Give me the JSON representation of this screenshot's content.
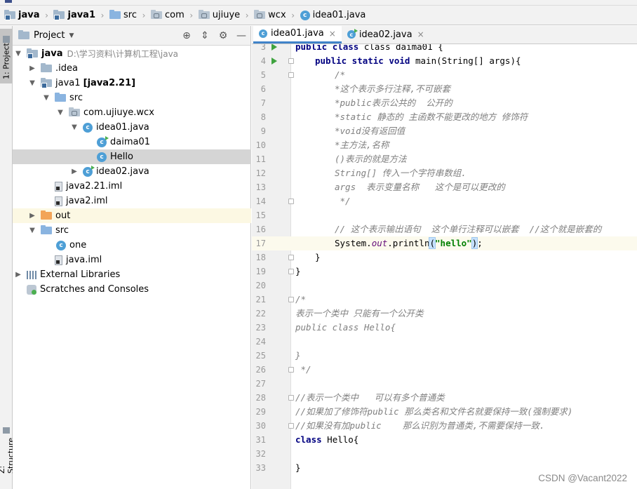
{
  "breadcrumb": [
    "java",
    "java1",
    "src",
    "com",
    "ujiuye",
    "wcx",
    "idea01.java"
  ],
  "left_tools": {
    "project": "1: Project",
    "structure": "Z: Structure"
  },
  "project_panel": {
    "title": "Project",
    "tree": [
      {
        "label": "java",
        "extra": "D:\\学习资料\\计算机工程\\java",
        "bold": true
      },
      {
        "label": ".idea"
      },
      {
        "label": "java1",
        "extra": "[java2.21]",
        "bold_extra": true
      },
      {
        "label": "src"
      },
      {
        "label": "com.ujiuye.wcx"
      },
      {
        "label": "idea01.java"
      },
      {
        "label": "daima01"
      },
      {
        "label": "Hello"
      },
      {
        "label": "idea02.java"
      },
      {
        "label": "java2.21.iml"
      },
      {
        "label": "java2.iml"
      },
      {
        "label": "out"
      },
      {
        "label": "src"
      },
      {
        "label": "one"
      },
      {
        "label": "java.iml"
      },
      {
        "label": "External Libraries"
      },
      {
        "label": "Scratches and Consoles"
      }
    ]
  },
  "editor": {
    "tabs": [
      {
        "label": "idea01.java",
        "active": true
      },
      {
        "label": "idea02.java",
        "active": false
      }
    ],
    "code": {
      "l3": {
        "n": "3",
        "t": "class daima01 {",
        "kw": "public"
      },
      "l4": {
        "n": "4",
        "kw": "public static void",
        "t": " main(String[] args){"
      },
      "l5": {
        "n": "5",
        "t": "/*"
      },
      "l6": {
        "n": "6",
        "t": "*这个表示多行注释,不可嵌套"
      },
      "l7": {
        "n": "7",
        "t": "*public表示公共的  公开的"
      },
      "l8": {
        "n": "8",
        "t": "*static 静态的 主函数不能更改的地方 修饰符"
      },
      "l9": {
        "n": "9",
        "t": "*void没有返回值"
      },
      "l10": {
        "n": "10",
        "t": "*主方法,名称"
      },
      "l11": {
        "n": "11",
        "t": "()表示的就是方法"
      },
      "l12": {
        "n": "12",
        "t": "String[] 传入一个字符串数组."
      },
      "l13": {
        "n": "13",
        "t": "args  表示变量名称   这个是可以更改的"
      },
      "l14": {
        "n": "14",
        "t": " */"
      },
      "l15": {
        "n": "15",
        "t": ""
      },
      "l16": {
        "n": "16",
        "t": "// 这个表示输出语句  这个单行注释可以嵌套  //这个就是嵌套的"
      },
      "l17": {
        "n": "17",
        "a": "System.",
        "b": "out",
        "c": ".println",
        "d": "(",
        "e": "\"hello\"",
        "f": ")",
        "g": ";"
      },
      "l18": {
        "n": "18",
        "t": "}"
      },
      "l19": {
        "n": "19",
        "t": "}"
      },
      "l20": {
        "n": "20",
        "t": ""
      },
      "l21": {
        "n": "21",
        "t": "/*"
      },
      "l22": {
        "n": "22",
        "t": "表示一个类中 只能有一个公开类"
      },
      "l23": {
        "n": "23",
        "t": "public class Hello{"
      },
      "l24": {
        "n": "24",
        "t": ""
      },
      "l25": {
        "n": "25",
        "t": "}"
      },
      "l26": {
        "n": "26",
        "t": " */"
      },
      "l27": {
        "n": "27",
        "t": ""
      },
      "l28": {
        "n": "28",
        "t": "//表示一个类中   可以有多个普通类"
      },
      "l29": {
        "n": "29",
        "t": "//如果加了修饰符public 那么类名和文件名就要保持一致(强制要求)"
      },
      "l30": {
        "n": "30",
        "t": "//如果没有加public    那么识别为普通类,不需要保持一致."
      },
      "l31": {
        "n": "31",
        "kw": "class",
        "t": " Hello{"
      },
      "l32": {
        "n": "32",
        "t": ""
      },
      "l33": {
        "n": "33",
        "t": "}"
      }
    }
  },
  "watermark": "CSDN @Vacant2022"
}
